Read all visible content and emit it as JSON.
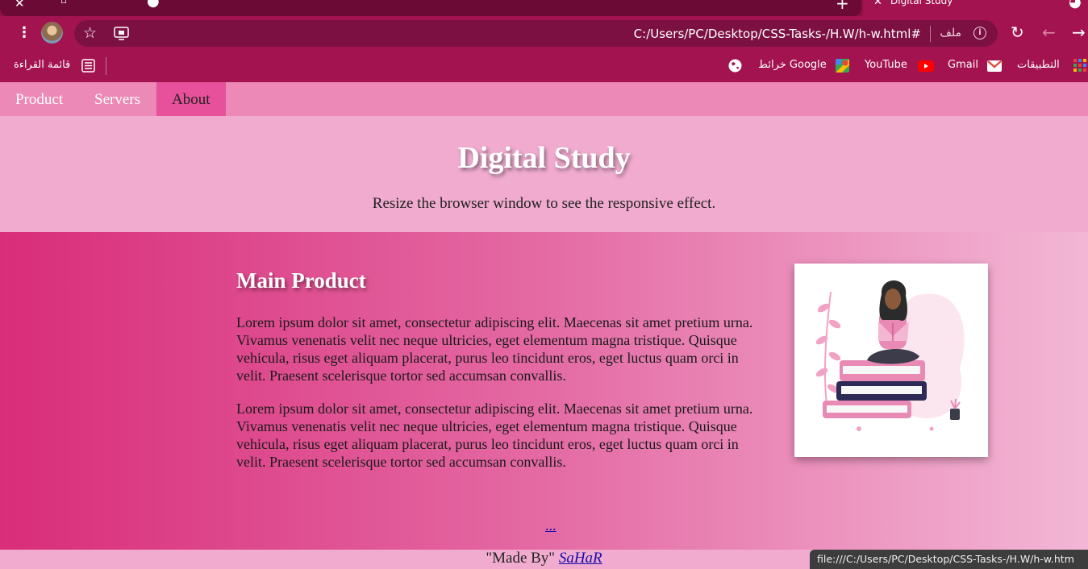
{
  "browser": {
    "active_tab_title": "Digital Study",
    "url": "C:/Users/PC/Desktop/CSS-Tasks-/H.W/h-w.html#",
    "url_scheme_label": "ملف",
    "bookmarks": {
      "reading_list": "قائمة القراءة",
      "maps": "خرائط Google",
      "youtube": "YouTube",
      "gmail": "Gmail",
      "apps": "التطبيقات"
    },
    "status_url": "file:///C:/Users/PC/Desktop/CSS-Tasks-/H.W/h-w.htm"
  },
  "nav": {
    "items": [
      {
        "label": "Product"
      },
      {
        "label": "Servers"
      },
      {
        "label": "About"
      }
    ],
    "active": "About"
  },
  "header": {
    "title": "Digital Study",
    "subtitle": "Resize the browser window to see the responsive effect."
  },
  "main": {
    "heading": "Main Product",
    "paragraphs": [
      "Lorem ipsum dolor sit amet, consectetur adipiscing elit. Maecenas sit amet pretium urna. Vivamus venenatis velit nec neque ultricies, eget elementum magna tristique. Quisque vehicula, risus eget aliquam placerat, purus leo tincidunt eros, eget luctus quam orci in velit. Praesent scelerisque tortor sed accumsan convallis.",
      "Lorem ipsum dolor sit amet, consectetur adipiscing elit. Maecenas sit amet pretium urna. Vivamus venenatis velit nec neque ultricies, eget elementum magna tristique. Quisque vehicula, risus eget aliquam placerat, purus leo tincidunt eros, eget luctus quam orci in velit. Praesent scelerisque tortor sed accumsan convallis."
    ],
    "more_link": "..."
  },
  "footer": {
    "prefix": "\"Made By\"",
    "author": "SaHaR"
  },
  "colors": {
    "chrome": "#a3134f",
    "nav_bg": "#ec89b6",
    "nav_active": "#e7509a",
    "header_bg": "#f0abcf",
    "gradient_start": "#d92d79",
    "gradient_end": "#f3b7d5"
  },
  "icons": {
    "close_tab": "close-icon",
    "new_tab": "plus-icon",
    "menu": "kebab-menu-icon",
    "bookmark": "star-icon",
    "cast": "cast-icon",
    "site_info": "info-icon",
    "reload": "reload-icon",
    "back": "back-arrow-icon",
    "forward": "forward-arrow-icon",
    "reading_list": "reading-list-icon",
    "world": "globe-icon",
    "maps": "maps-icon",
    "youtube": "youtube-icon",
    "gmail": "gmail-icon",
    "apps": "apps-grid-icon",
    "illustration": "reading-girl-illustration"
  }
}
